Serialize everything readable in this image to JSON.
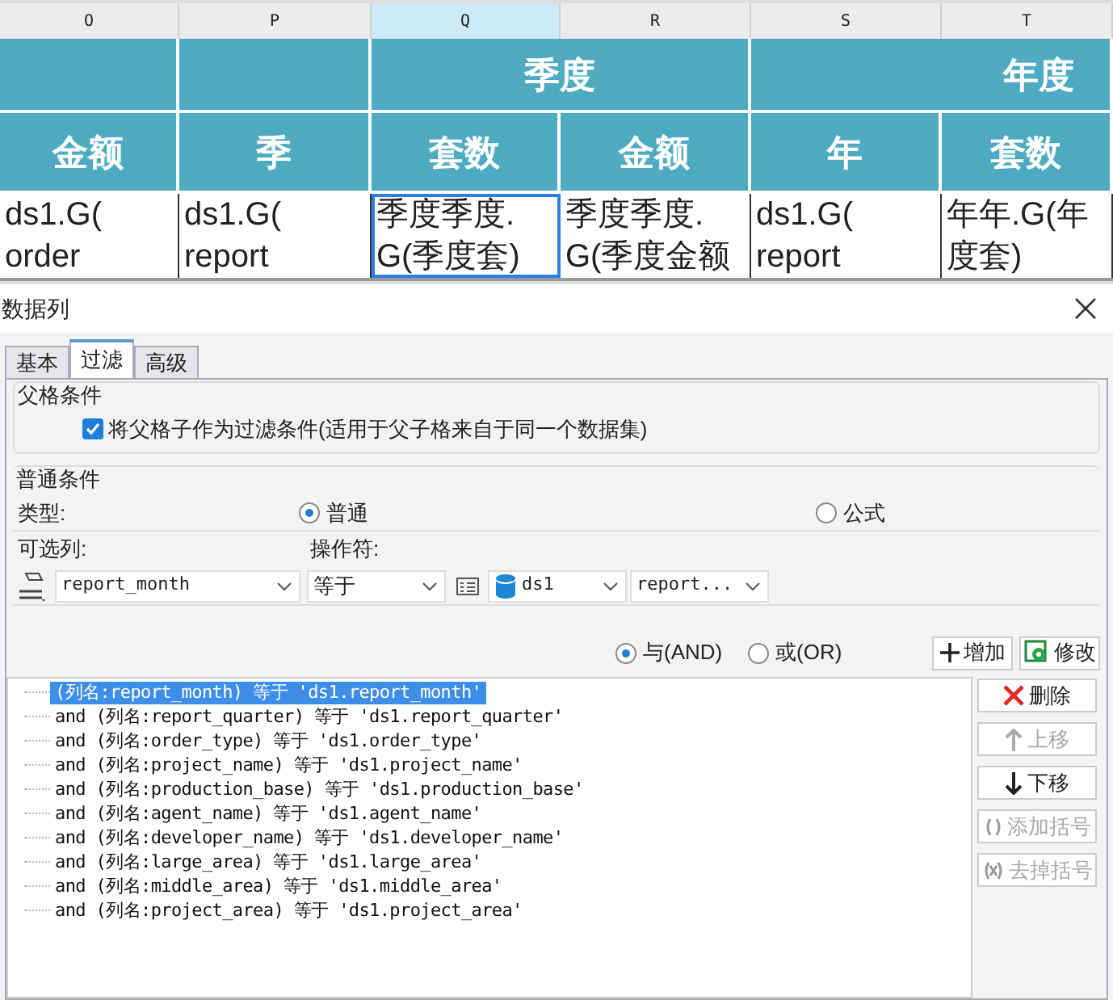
{
  "sheet": {
    "columns": [
      {
        "label": "O",
        "selected": false
      },
      {
        "label": "P",
        "selected": false
      },
      {
        "label": "Q",
        "selected": true
      },
      {
        "label": "R",
        "selected": false
      },
      {
        "label": "S",
        "selected": false
      },
      {
        "label": "T",
        "selected": false
      }
    ],
    "group_headers": [
      "季度",
      "年度"
    ],
    "headers": [
      "金额",
      "季",
      "套数",
      "金额",
      "年",
      "套数"
    ],
    "cells": [
      {
        "text": "ds1.G( order",
        "selected": false
      },
      {
        "text": "ds1.G( report",
        "selected": false
      },
      {
        "text": "季度季度. G(季度套)",
        "selected": true
      },
      {
        "text": "季度季度. G(季度金额",
        "selected": false
      },
      {
        "text": "ds1.G( report",
        "selected": false
      },
      {
        "text": "年年.G(年度套)",
        "selected": false
      }
    ]
  },
  "dialog": {
    "title": "数据列",
    "tabs": [
      {
        "label": "基本",
        "selected": false
      },
      {
        "label": "过滤",
        "selected": true
      },
      {
        "label": "高级",
        "selected": false
      }
    ],
    "parent_condition": {
      "title": "父格条件",
      "checkbox": {
        "label": "将父格子作为过滤条件(适用于父子格来自于同一个数据集)",
        "checked": true
      }
    },
    "normal_condition": {
      "title": "普通条件",
      "type_label": "类型:",
      "type_options": [
        {
          "label": "普通",
          "selected": true
        },
        {
          "label": "公式",
          "selected": false
        }
      ],
      "column_label": "可选列:",
      "operator_label": "操作符:",
      "column_combo": "report_month",
      "operator_combo": "等于",
      "dataset_combo": "ds1",
      "field_combo": "report..."
    },
    "logic_options": [
      {
        "label": "与(AND)",
        "selected": true
      },
      {
        "label": "或(OR)",
        "selected": false
      }
    ],
    "add_button": "增加",
    "modify_button": "修改",
    "conditions": [
      {
        "text": "(列名:report_month) 等于 'ds1.report_month'",
        "selected": true
      },
      {
        "text": "and (列名:report_quarter) 等于 'ds1.report_quarter'",
        "selected": false
      },
      {
        "text": "and (列名:order_type) 等于 'ds1.order_type'",
        "selected": false
      },
      {
        "text": "and (列名:project_name) 等于 'ds1.project_name'",
        "selected": false
      },
      {
        "text": "and (列名:production_base) 等于 'ds1.production_base'",
        "selected": false
      },
      {
        "text": "and (列名:agent_name) 等于 'ds1.agent_name'",
        "selected": false
      },
      {
        "text": "and (列名:developer_name) 等于 'ds1.developer_name'",
        "selected": false
      },
      {
        "text": "and (列名:large_area) 等于 'ds1.large_area'",
        "selected": false
      },
      {
        "text": "and (列名:middle_area) 等于 'ds1.middle_area'",
        "selected": false
      },
      {
        "text": "and (列名:project_area) 等于 'ds1.project_area'",
        "selected": false
      }
    ],
    "side_buttons": [
      {
        "kind": "delete",
        "label": "删除",
        "disabled": false
      },
      {
        "kind": "up",
        "label": "上移",
        "disabled": true
      },
      {
        "kind": "down",
        "label": "下移",
        "disabled": false
      },
      {
        "kind": "add-bracket",
        "label": "添加括号",
        "disabled": true
      },
      {
        "kind": "remove-bracket",
        "label": "去掉括号",
        "disabled": true
      }
    ]
  }
}
